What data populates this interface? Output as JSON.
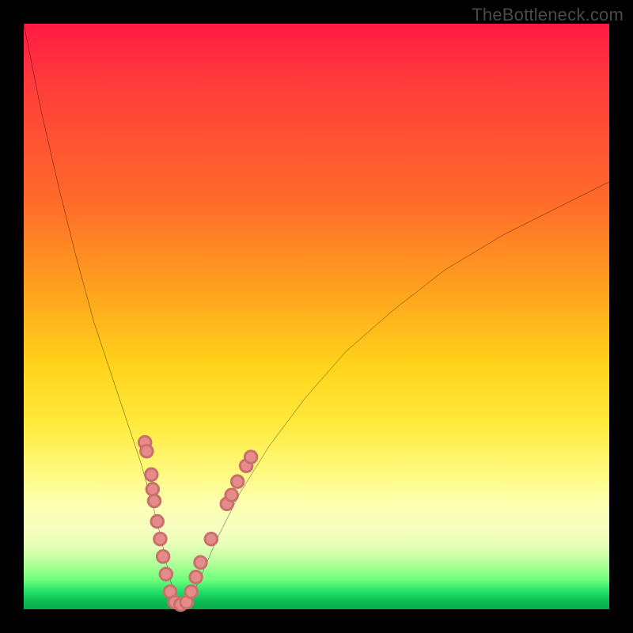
{
  "watermark": "TheBottleneck.com",
  "chart_data": {
    "type": "line",
    "title": "",
    "xlabel": "",
    "ylabel": "",
    "xlim": [
      0,
      100
    ],
    "ylim": [
      0,
      100
    ],
    "grid": false,
    "legend": false,
    "series": [
      {
        "name": "bottleneck-curve",
        "x": [
          0,
          3,
          6,
          9,
          12,
          15,
          18,
          20,
          22,
          23.5,
          25,
          26.5,
          28,
          30,
          33,
          37,
          42,
          48,
          55,
          63,
          72,
          82,
          92,
          100
        ],
        "y": [
          100,
          85,
          72,
          60,
          49,
          40,
          31,
          25,
          18,
          12,
          5,
          1,
          1,
          5,
          12,
          20,
          28,
          36,
          44,
          51,
          58,
          64,
          69,
          73
        ]
      }
    ],
    "markers": {
      "name": "highlight-dots",
      "points": [
        {
          "x": 20.7,
          "y": 28.5
        },
        {
          "x": 21.0,
          "y": 27.0
        },
        {
          "x": 21.8,
          "y": 23.0
        },
        {
          "x": 22.0,
          "y": 20.5
        },
        {
          "x": 22.3,
          "y": 18.5
        },
        {
          "x": 22.8,
          "y": 15.0
        },
        {
          "x": 23.3,
          "y": 12.0
        },
        {
          "x": 23.8,
          "y": 9.0
        },
        {
          "x": 24.3,
          "y": 6.0
        },
        {
          "x": 25.0,
          "y": 3.0
        },
        {
          "x": 25.8,
          "y": 1.2
        },
        {
          "x": 26.8,
          "y": 0.8
        },
        {
          "x": 27.8,
          "y": 1.2
        },
        {
          "x": 28.6,
          "y": 3.0
        },
        {
          "x": 29.4,
          "y": 5.5
        },
        {
          "x": 30.2,
          "y": 8.0
        },
        {
          "x": 32.0,
          "y": 12.0
        },
        {
          "x": 34.7,
          "y": 18.0
        },
        {
          "x": 35.5,
          "y": 19.5
        },
        {
          "x": 36.5,
          "y": 21.8
        },
        {
          "x": 38.0,
          "y": 24.5
        },
        {
          "x": 38.8,
          "y": 26.0
        }
      ]
    },
    "background_gradient": {
      "direction": "vertical",
      "stops": [
        {
          "pos": 0.0,
          "color": "#ff1a44"
        },
        {
          "pos": 0.3,
          "color": "#ff6a2a"
        },
        {
          "pos": 0.58,
          "color": "#ffd21a"
        },
        {
          "pos": 0.82,
          "color": "#feffb0"
        },
        {
          "pos": 0.95,
          "color": "#6dff7a"
        },
        {
          "pos": 1.0,
          "color": "#0aa94a"
        }
      ]
    }
  }
}
